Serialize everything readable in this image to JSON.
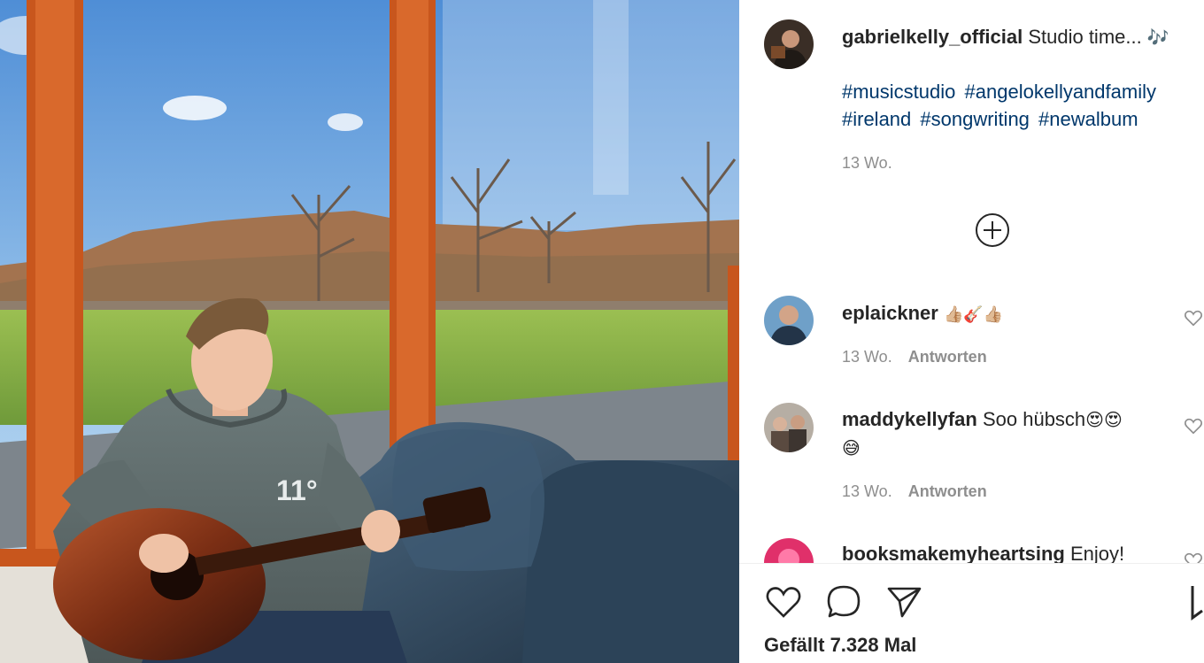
{
  "post": {
    "author": "gabrielkelly_official",
    "caption": "Studio time...",
    "caption_emoji": "🎶",
    "hashtags": [
      "#musicstudio",
      "#angelokellyandfamily",
      "#ireland",
      "#songwriting",
      "#newalbum"
    ],
    "age": "13 Wo.",
    "likes_text": "Gefällt 7.328 Mal"
  },
  "comments": [
    {
      "username": "eplaickner",
      "text": "",
      "emoji": "👍🏼🎸👍🏼",
      "age": "13 Wo.",
      "reply": "Antworten"
    },
    {
      "username": "maddykellyfan",
      "text": "Soo hübsch",
      "emoji": "😍😍",
      "emoji2": "😅",
      "age": "13 Wo.",
      "reply": "Antworten"
    },
    {
      "username": "booksmakemyheartsing",
      "text": "Enjoy!"
    }
  ],
  "photo": {
    "hoodie_logo": "11°"
  },
  "icons": {
    "load_more": "plus-circle-icon",
    "like": "heart-icon",
    "comment": "comment-bubble-icon",
    "share": "paper-plane-icon",
    "save": "bookmark-icon"
  },
  "colors": {
    "hashtag": "#00376b",
    "meta": "#8e8e8e",
    "text": "#262626",
    "notes_emoji": "#3897f0"
  }
}
